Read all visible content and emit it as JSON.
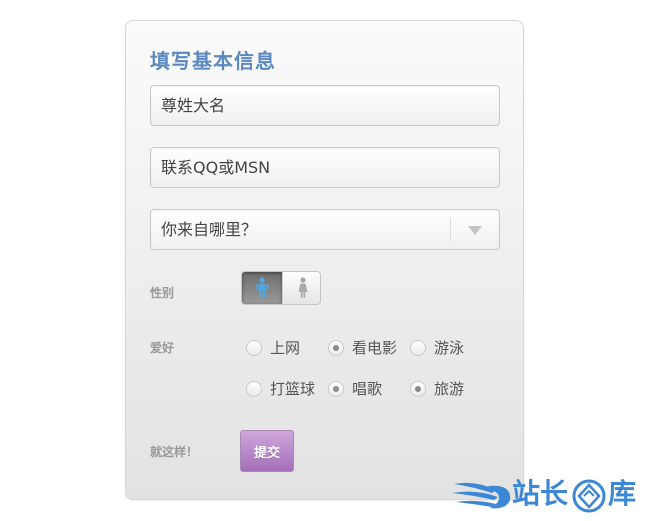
{
  "form": {
    "title": "填写基本信息",
    "name_field": {
      "value": "尊姓大名"
    },
    "contact_field": {
      "value": "联系QQ或MSN"
    },
    "region_select": {
      "selected": "你来自哪里？"
    },
    "gender": {
      "label": "性别",
      "selected": "male"
    },
    "hobbies": {
      "label": "爱好",
      "options": [
        {
          "label": "上网",
          "checked": false
        },
        {
          "label": "看电影",
          "checked": true
        },
        {
          "label": "游泳",
          "checked": false
        },
        {
          "label": "打篮球",
          "checked": false
        },
        {
          "label": "唱歌",
          "checked": true
        },
        {
          "label": "旅游",
          "checked": true
        }
      ]
    },
    "submit": {
      "label": "就这样！",
      "button": "提交"
    }
  },
  "watermark": {
    "brand": "站长库",
    "logo": "feather-wings-diamond-logo"
  },
  "colors": {
    "title": "#5b8ac0",
    "submit": "#b27fc5",
    "gender_active": "#6c6c6c",
    "male_icon": "#4fa8e0",
    "watermark": "#3d88d6"
  }
}
